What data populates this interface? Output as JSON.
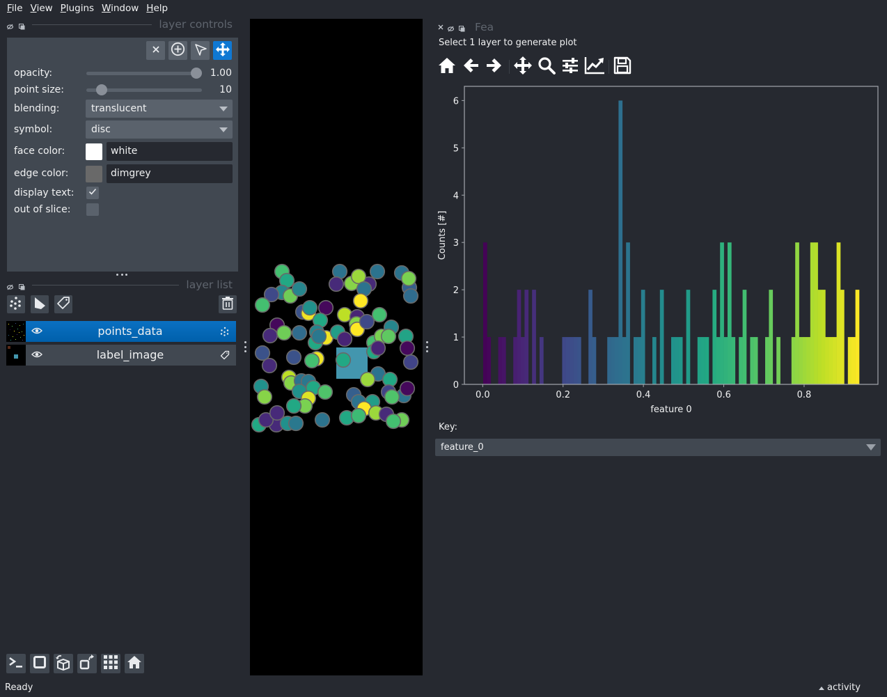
{
  "menu": {
    "items": [
      "File",
      "View",
      "Plugins",
      "Window",
      "Help"
    ]
  },
  "layer_controls": {
    "title": "layer controls",
    "mode_buttons": [
      {
        "icon": "close-icon",
        "active": false
      },
      {
        "icon": "add-point-icon",
        "active": false
      },
      {
        "icon": "select-arrow-icon",
        "active": false
      },
      {
        "icon": "pan-zoom-icon",
        "active": true
      }
    ],
    "opacity": {
      "label": "opacity:",
      "value": 1.0,
      "display": "1.00",
      "fraction": 1.0
    },
    "point_size": {
      "label": "point size:",
      "value": 10,
      "display": "10",
      "fraction": 0.09
    },
    "blending": {
      "label": "blending:",
      "value": "translucent"
    },
    "symbol": {
      "label": "symbol:",
      "value": "disc"
    },
    "face_color": {
      "label": "face color:",
      "value": "white",
      "swatch": "#ffffff"
    },
    "edge_color": {
      "label": "edge color:",
      "value": "dimgrey",
      "swatch": "#696969"
    },
    "display_text": {
      "label": "display text:",
      "checked": true
    },
    "out_of_slice": {
      "label": "out of slice:",
      "checked": false
    }
  },
  "layer_list": {
    "title": "layer list",
    "buttons": [
      "new-points-layer",
      "new-shapes-layer",
      "new-labels-layer",
      "delete-layer"
    ],
    "layers": [
      {
        "name": "points_data",
        "type": "points",
        "visible": true,
        "selected": true
      },
      {
        "name": "label_image",
        "type": "labels",
        "visible": true,
        "selected": false
      }
    ]
  },
  "viewer_buttons": [
    "console",
    "ndisplay-toggle",
    "roll-dimensions",
    "transpose-dimensions",
    "grid-view",
    "reset-view"
  ],
  "plot_panel": {
    "title": "Fea",
    "message": "Select 1 layer to generate plot",
    "toolbar": [
      "home",
      "back",
      "forward",
      "pan",
      "zoom",
      "configure-subplots",
      "edit-axis",
      "save"
    ],
    "key_label": "Key:",
    "key_value": "feature_0"
  },
  "status": {
    "text": "Ready",
    "activity_label": "activity"
  },
  "colors": {
    "background": "#262930",
    "panel": "#414851",
    "accent": "#0f78d3",
    "canvas": "#000000",
    "label_region": "#4396ae"
  },
  "chart_data": {
    "type": "bar",
    "subtype": "histogram",
    "title": "",
    "xlabel": "feature 0",
    "ylabel": "Counts [#]",
    "xlim": [
      -0.0456,
      0.9838
    ],
    "ylim": [
      0,
      6.3
    ],
    "x_ticks": [
      0.0,
      0.2,
      0.4,
      0.6,
      0.8
    ],
    "x_tick_labels": [
      "0.0",
      "0.2",
      "0.4",
      "0.6",
      "0.8"
    ],
    "y_ticks": [
      0,
      1,
      2,
      3,
      4,
      5,
      6
    ],
    "y_tick_labels": [
      "0",
      "1",
      "2",
      "3",
      "4",
      "5",
      "6"
    ],
    "grid": false,
    "colormap": "viridis",
    "bin_range": [
      0.0012,
      0.937
    ],
    "counts": [
      3,
      1,
      0,
      0,
      1,
      1,
      0,
      0,
      1,
      2,
      1,
      2,
      0,
      2,
      0,
      1,
      0,
      0,
      0,
      0,
      0,
      1,
      1,
      1,
      1,
      1,
      0,
      0,
      2,
      1,
      0,
      0,
      0,
      1,
      1,
      1,
      6,
      1,
      3,
      0,
      1,
      1,
      2,
      0,
      0,
      1,
      0,
      2,
      0,
      0,
      1,
      1,
      1,
      0,
      2,
      0,
      0,
      1,
      1,
      1,
      0,
      2,
      1,
      3,
      1,
      3,
      1,
      0,
      1,
      2,
      0,
      1,
      1,
      0,
      0,
      1,
      2,
      0,
      1,
      0,
      0,
      0,
      1,
      3,
      1,
      1,
      1,
      3,
      3,
      2,
      2,
      1,
      1,
      1,
      3,
      2,
      0,
      1,
      1,
      2
    ]
  }
}
